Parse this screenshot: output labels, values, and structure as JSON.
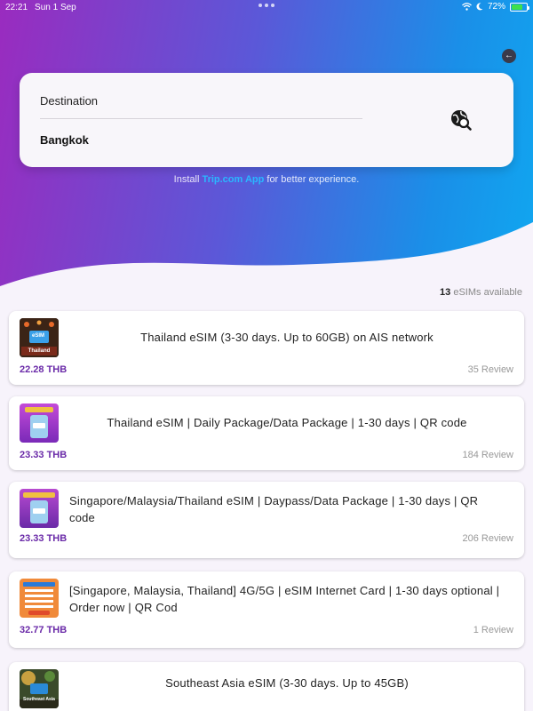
{
  "status": {
    "time": "22:21",
    "date": "Sun 1 Sep",
    "battery": "72%",
    "battery_level": 0.72
  },
  "search": {
    "label": "Destination",
    "value": "Bangkok",
    "icon": "globe-search-icon"
  },
  "install": {
    "prefix": "Install ",
    "link": "Trip.com App",
    "suffix": " for better experience."
  },
  "results": {
    "count": "13",
    "suffix": "eSIMs available"
  },
  "esims": [
    {
      "title": "Thailand eSIM (3-30 days. Up to 60GB) on AIS network",
      "price": "22.28 THB",
      "reviews": "35 Review"
    },
    {
      "title": "Thailand eSIM | Daily Package/Data Package | 1-30 days | QR code",
      "price": "23.33 THB",
      "reviews": "184 Review"
    },
    {
      "title": "Singapore/Malaysia/Thailand eSIM | Daypass/Data Package | 1-30 days | QR code",
      "price": "23.33 THB",
      "reviews": "206 Review"
    },
    {
      "title": "[Singapore, Malaysia, Thailand] 4G/5G | eSIM Internet Card | 1-30 days optional | Order now | QR Cod",
      "price": "32.77 THB",
      "reviews": "1 Review"
    },
    {
      "title": "Southeast Asia eSIM (3-30 days. Up to 45GB)",
      "price": "",
      "reviews": ""
    }
  ],
  "thumb_texts": {
    "t1_badge": "eSIM",
    "t1_label": "Thailand",
    "t5_label": "Southeast Asia"
  },
  "colors": {
    "price": "#6a2aa8",
    "link": "#2ab7ff",
    "gradient_start": "#9a2bbf",
    "gradient_end": "#10a7f0"
  }
}
